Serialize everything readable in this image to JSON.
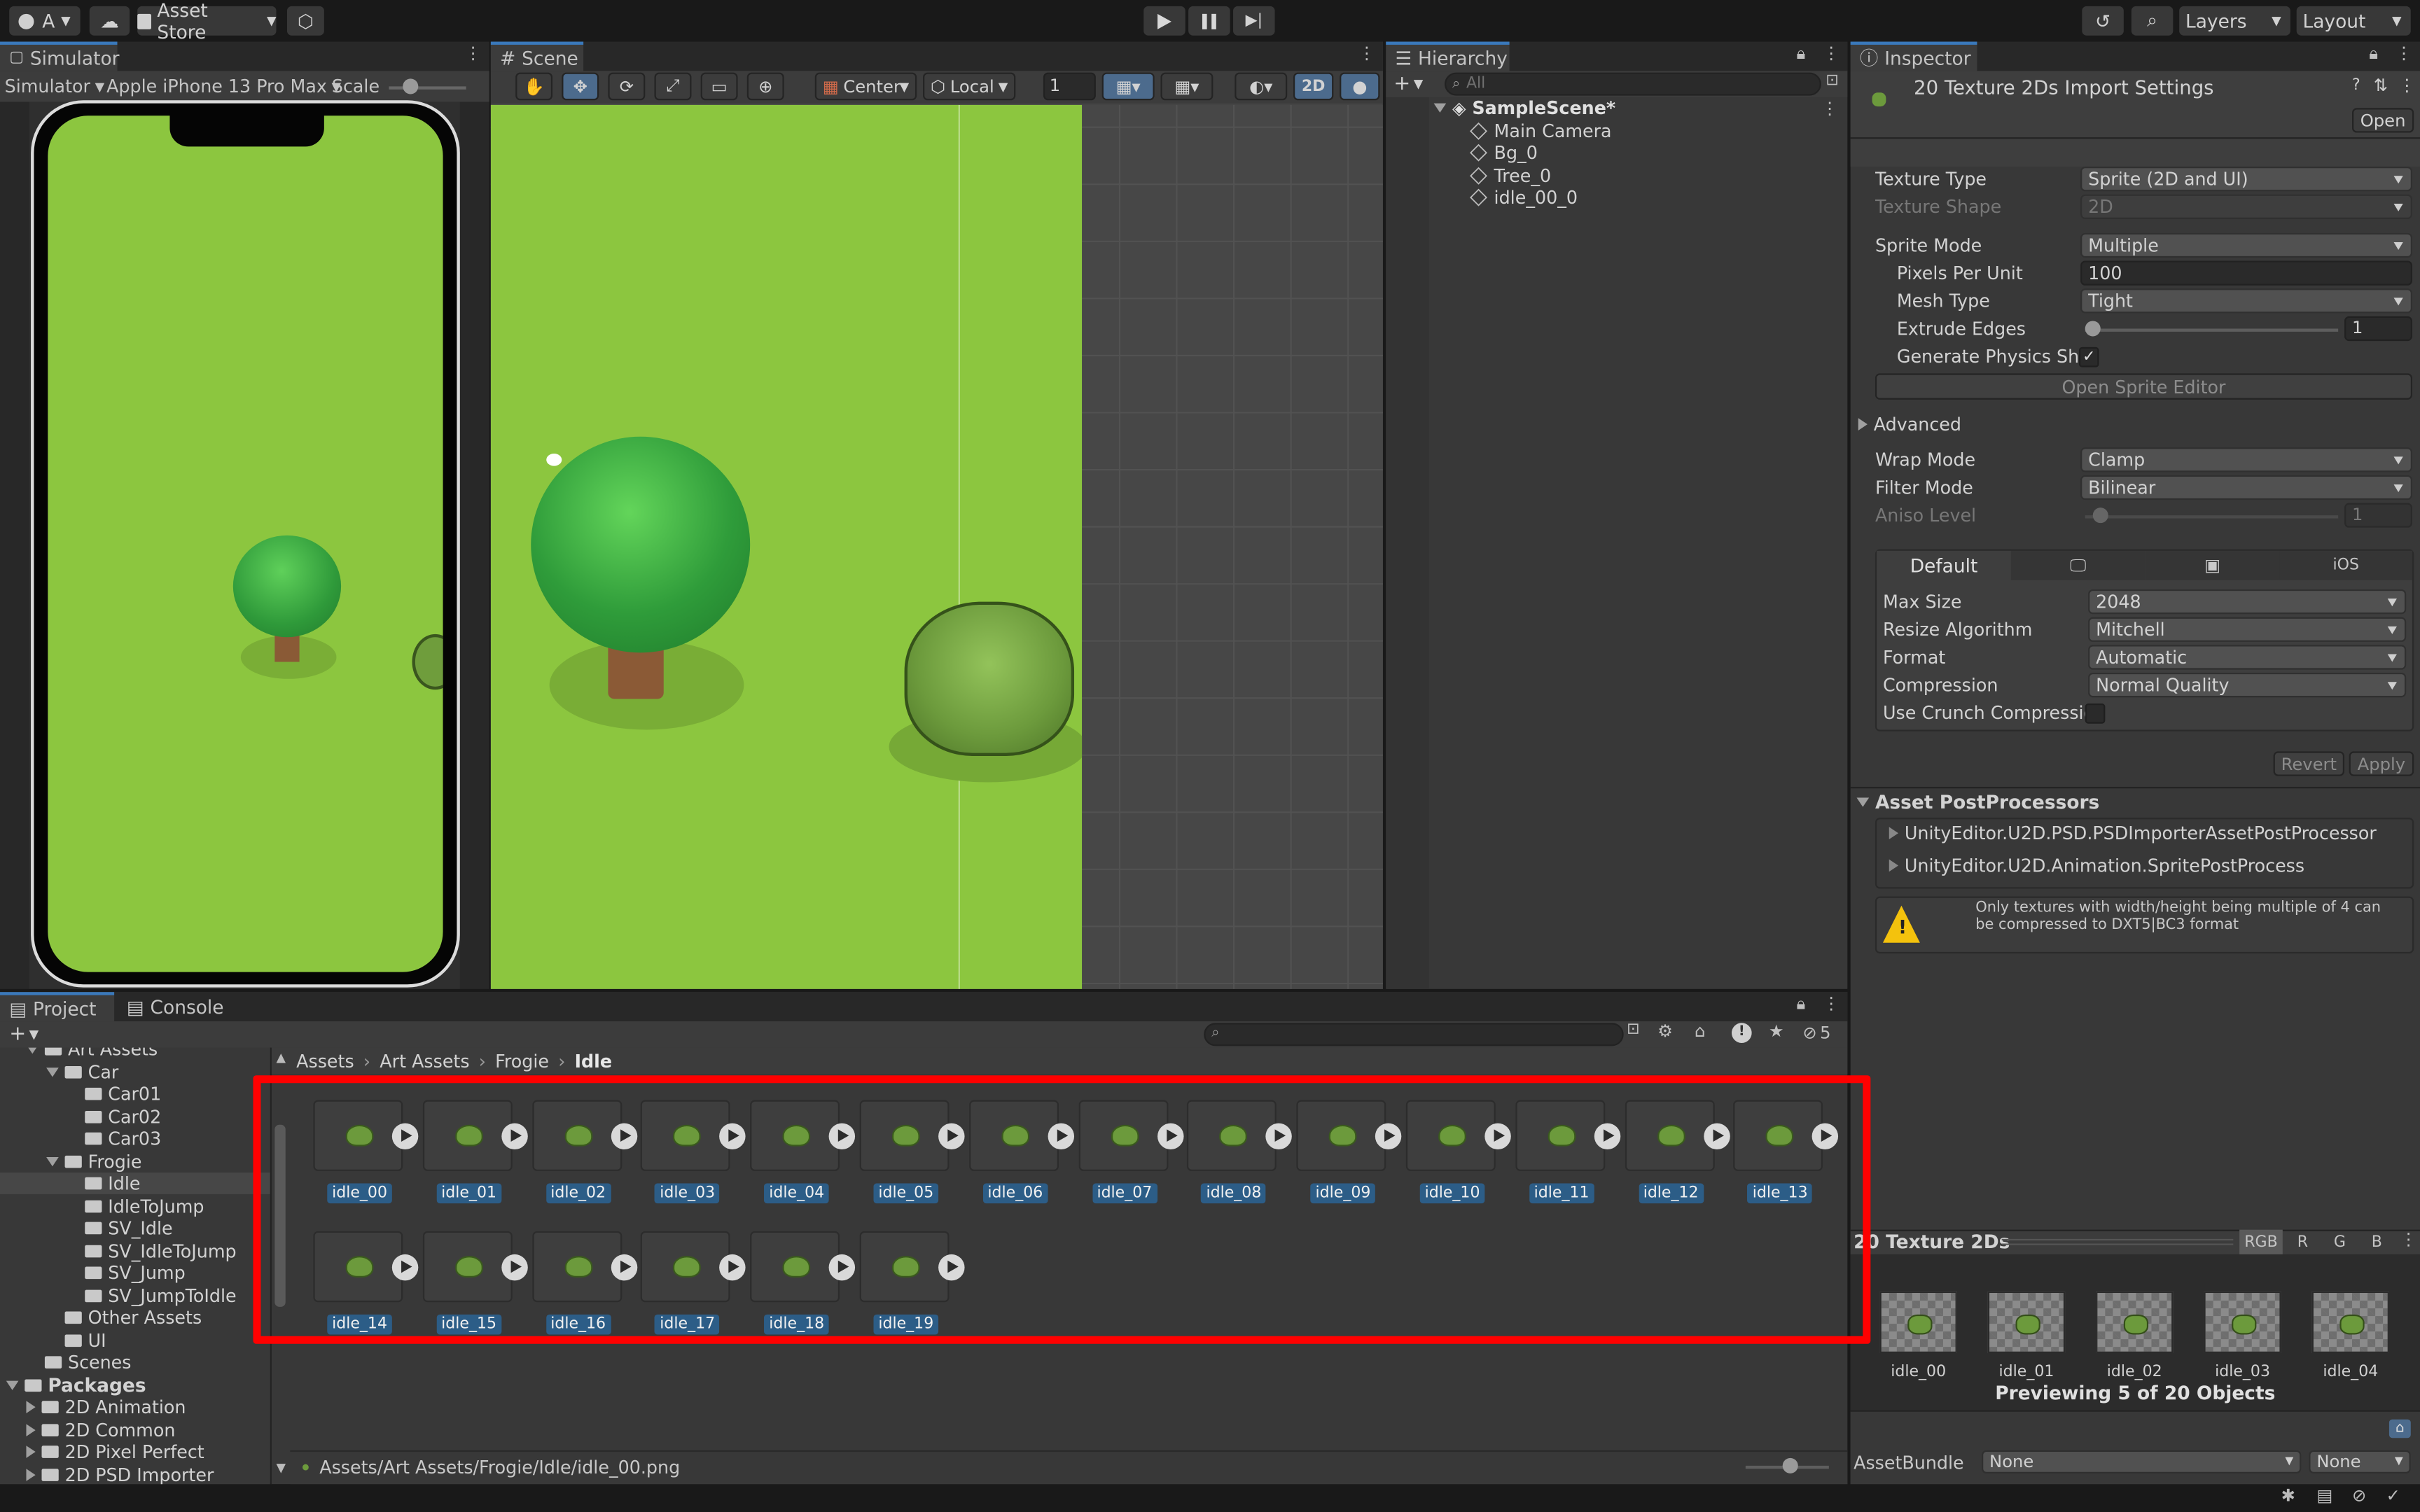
{
  "toolbar": {
    "account": "A",
    "asset_store": "Asset Store",
    "layers": "Layers",
    "layout": "Layout"
  },
  "simulator": {
    "tab": "Simulator",
    "mode": "Simulator",
    "device": "Apple iPhone 13 Pro Max",
    "scale_label": "Scale"
  },
  "scene": {
    "tab": "Scene",
    "pivot": "Center",
    "space": "Local",
    "grid_value": "1",
    "mode_2d": "2D"
  },
  "hierarchy": {
    "tab": "Hierarchy",
    "search_placeholder": "All",
    "scene_name": "SampleScene*",
    "items": [
      "Main Camera",
      "Bg_0",
      "Tree_0",
      "idle_00_0"
    ]
  },
  "inspector": {
    "tab": "Inspector",
    "title": "20 Texture 2Ds Import Settings",
    "open_button": "Open",
    "rows": [
      {
        "label": "Texture Type",
        "value": "Sprite (2D and UI)"
      },
      {
        "label": "Texture Shape",
        "value": "2D"
      },
      {
        "label": "Sprite Mode",
        "value": "Multiple"
      },
      {
        "label": "Pixels Per Unit",
        "value": "100"
      },
      {
        "label": "Mesh Type",
        "value": "Tight"
      },
      {
        "label": "Extrude Edges",
        "value": "1"
      },
      {
        "label": "Generate Physics Shape"
      },
      {
        "label": "Wrap Mode",
        "value": "Clamp"
      },
      {
        "label": "Filter Mode",
        "value": "Bilinear"
      },
      {
        "label": "Aniso Level",
        "value": "1"
      }
    ],
    "open_sprite_editor": "Open Sprite Editor",
    "advanced": "Advanced",
    "platform_tabs": [
      "Default",
      "iOS"
    ],
    "platform_rows": [
      {
        "label": "Max Size",
        "value": "2048"
      },
      {
        "label": "Resize Algorithm",
        "value": "Mitchell"
      },
      {
        "label": "Format",
        "value": "Automatic"
      },
      {
        "label": "Compression",
        "value": "Normal Quality"
      },
      {
        "label": "Use Crunch Compression"
      }
    ],
    "revert": "Revert",
    "apply": "Apply",
    "postprocessors_title": "Asset PostProcessors",
    "postprocessors": [
      "UnityEditor.U2D.PSD.PSDImporterAssetPostProcessor",
      "UnityEditor.U2D.Animation.SpritePostProcess"
    ],
    "warning": "Only textures with width/height being multiple of 4 can be compressed to DXT5|BC3 format",
    "preview_title": "20 Texture 2Ds",
    "channels": [
      "RGB",
      "R",
      "G",
      "B"
    ],
    "preview_items": [
      "idle_00",
      "idle_01",
      "idle_02",
      "idle_03",
      "idle_04"
    ],
    "preview_caption": "Previewing 5 of 20 Objects",
    "assetbundle_label": "AssetBundle",
    "assetbundle_value": "None",
    "assetbundle_variant": "None"
  },
  "project": {
    "tabs": [
      "Project",
      "Console"
    ],
    "hidden_count": "5",
    "breadcrumb": [
      "Assets",
      "Art Assets",
      "Frogie",
      "Idle"
    ],
    "tree": [
      {
        "label": "Art Assets",
        "indent": 1,
        "arrow": "down"
      },
      {
        "label": "Car",
        "indent": 2,
        "arrow": "down"
      },
      {
        "label": "Car01",
        "indent": 3,
        "arrow": ""
      },
      {
        "label": "Car02",
        "indent": 3,
        "arrow": ""
      },
      {
        "label": "Car03",
        "indent": 3,
        "arrow": ""
      },
      {
        "label": "Frogie",
        "indent": 2,
        "arrow": "down"
      },
      {
        "label": "Idle",
        "indent": 3,
        "arrow": "",
        "selected": true
      },
      {
        "label": "IdleToJump",
        "indent": 3,
        "arrow": ""
      },
      {
        "label": "SV_Idle",
        "indent": 3,
        "arrow": ""
      },
      {
        "label": "SV_IdleToJump",
        "indent": 3,
        "arrow": ""
      },
      {
        "label": "SV_Jump",
        "indent": 3,
        "arrow": ""
      },
      {
        "label": "SV_JumpToIdle",
        "indent": 3,
        "arrow": ""
      },
      {
        "label": "Other Assets",
        "indent": 2,
        "arrow": ""
      },
      {
        "label": "UI",
        "indent": 2,
        "arrow": ""
      },
      {
        "label": "Scenes",
        "indent": 1,
        "arrow": ""
      },
      {
        "label": "Packages",
        "indent": 0,
        "arrow": "down",
        "bold": true
      },
      {
        "label": "2D Animation",
        "indent": 1,
        "arrow": "right"
      },
      {
        "label": "2D Common",
        "indent": 1,
        "arrow": "right"
      },
      {
        "label": "2D Pixel Perfect",
        "indent": 1,
        "arrow": "right"
      },
      {
        "label": "2D PSD Importer",
        "indent": 1,
        "arrow": "right"
      }
    ],
    "assets": [
      "idle_00",
      "idle_01",
      "idle_02",
      "idle_03",
      "idle_04",
      "idle_05",
      "idle_06",
      "idle_07",
      "idle_08",
      "idle_09",
      "idle_10",
      "idle_11",
      "idle_12",
      "idle_13",
      "idle_14",
      "idle_15",
      "idle_16",
      "idle_17",
      "idle_18",
      "idle_19"
    ],
    "status_path": "Assets/Art Assets/Frogie/Idle/idle_00.png"
  },
  "colors": {
    "accent": "#3a79bb",
    "selection": "#2c5d87",
    "highlight_box": "#ff0000",
    "grass": "#8cc63f"
  }
}
